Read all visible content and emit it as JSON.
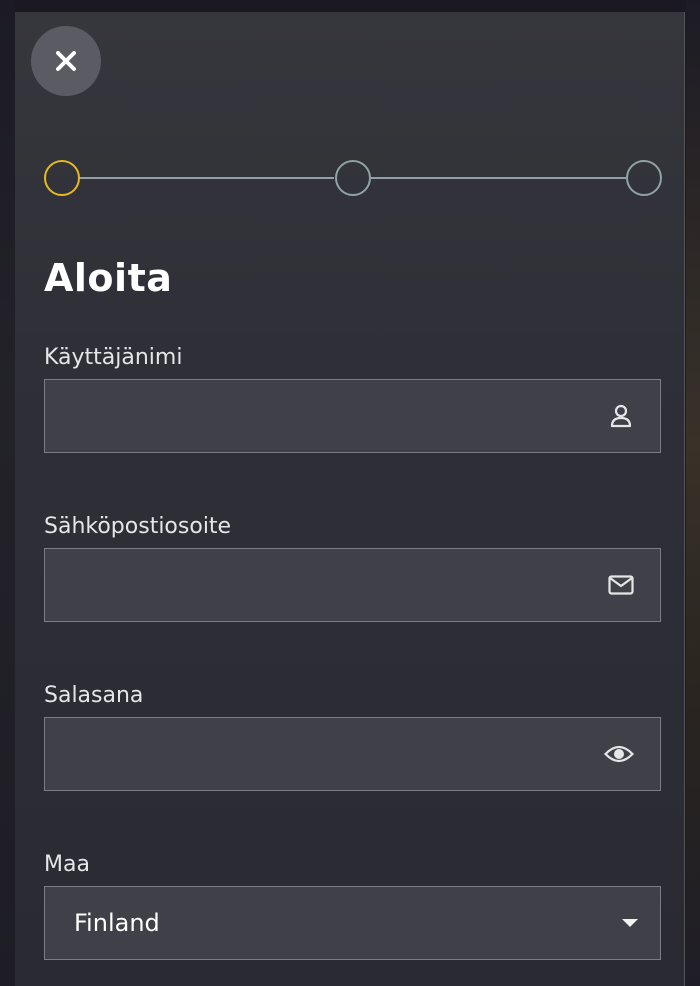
{
  "header": {
    "close_icon": "close-icon"
  },
  "stepper": {
    "total_steps": 3,
    "current_step": 1,
    "active_color": "#e6b821",
    "inactive_color": "#8fa3a4"
  },
  "form": {
    "title": "Aloita",
    "username": {
      "label": "Käyttäjänimi",
      "value": "",
      "icon": "user-icon"
    },
    "email": {
      "label": "Sähköpostiosoite",
      "value": "",
      "icon": "envelope-icon"
    },
    "password": {
      "label": "Salasana",
      "value": "",
      "icon": "eye-icon"
    },
    "country": {
      "label": "Maa",
      "selected": "Finland",
      "icon": "caret-down-icon"
    }
  }
}
